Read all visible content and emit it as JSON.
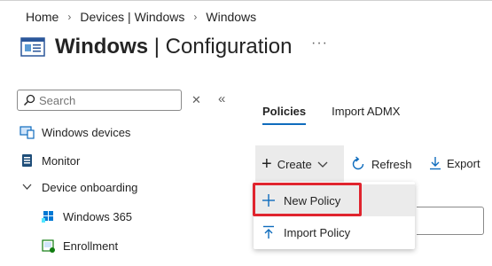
{
  "breadcrumb": [
    "Home",
    "Devices | Windows",
    "Windows"
  ],
  "title": {
    "bold": "Windows",
    "rest": " | Configuration",
    "more": "···"
  },
  "search": {
    "placeholder": "Search"
  },
  "nav": [
    {
      "label": "Windows devices",
      "icon": "devices-icon"
    },
    {
      "label": "Monitor",
      "icon": "monitor-icon"
    },
    {
      "label": "Device onboarding",
      "icon": "chevron-down-icon"
    },
    {
      "label": "Windows 365",
      "icon": "windows365-icon"
    },
    {
      "label": "Enrollment",
      "icon": "enrollment-icon"
    }
  ],
  "tabs": [
    "Policies",
    "Import ADMX"
  ],
  "toolbar": {
    "create": "Create",
    "refresh": "Refresh",
    "export": "Export"
  },
  "dropdown": [
    "New Policy",
    "Import Policy"
  ],
  "colors": {
    "accent": "#0f6cbd",
    "highlight_box": "#e0242e"
  }
}
